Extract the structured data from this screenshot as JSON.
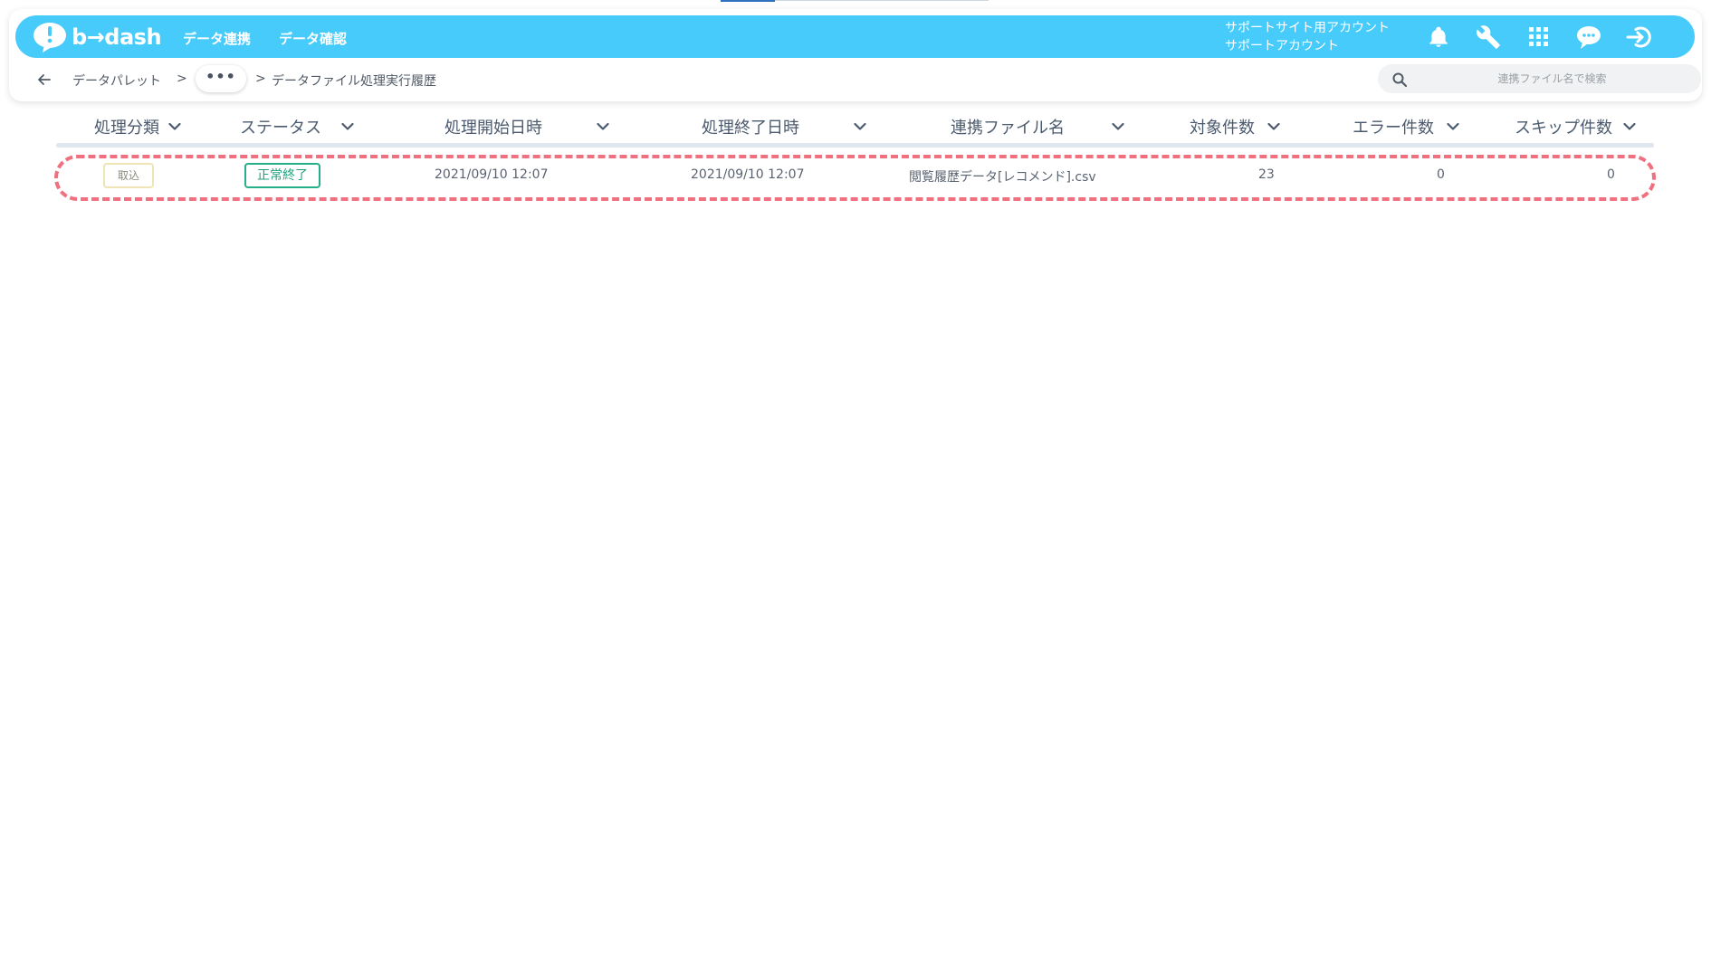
{
  "header": {
    "logo_text": "b→dash",
    "nav": [
      "データ連携",
      "データ確認"
    ],
    "account_line1": "サポートサイト用アカウント",
    "account_line2": "サポートアカウント",
    "icons": [
      "bell-icon",
      "wrench-icon",
      "apps-grid-icon",
      "support-chat-icon",
      "logout-icon"
    ]
  },
  "breadcrumb": {
    "back": "back-arrow-icon",
    "items": [
      "データパレット",
      "データファイル処理実行履歴"
    ],
    "separator": ">",
    "ellipsis": "•••"
  },
  "search": {
    "placeholder": "連携ファイル名で検索"
  },
  "table": {
    "columns": [
      "処理分類",
      "ステータス",
      "処理開始日時",
      "処理終了日時",
      "連携ファイル名",
      "対象件数",
      "エラー件数",
      "スキップ件数"
    ],
    "rows": [
      {
        "type": "取込",
        "status": "正常終了",
        "start": "2021/09/10 12:07",
        "end": "2021/09/10 12:07",
        "file": "閲覧履歴データ[レコメンド].csv",
        "target": "23",
        "errors": "0",
        "skips": "0"
      }
    ]
  },
  "colors": {
    "header_bg": "#47cbfb",
    "highlight": "#f07080",
    "status_ok": "#25b08a"
  }
}
